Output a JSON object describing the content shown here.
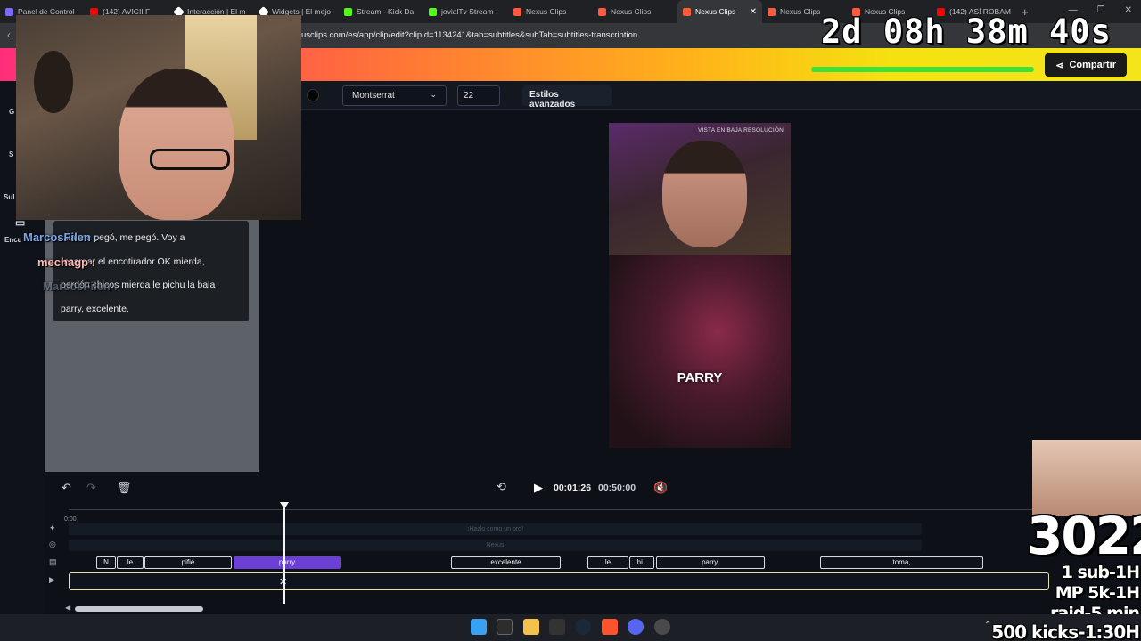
{
  "browser": {
    "tabs": [
      {
        "label": "Panel de Control",
        "color": "#7b6cff"
      },
      {
        "label": "(142) AVICII F",
        "color": "#ff0000"
      },
      {
        "label": "Interacción | El m",
        "color": "#ffffff"
      },
      {
        "label": "Widgets | El mejo",
        "color": "#ffffff"
      },
      {
        "label": "Stream - Kick Da",
        "color": "#53fc18"
      },
      {
        "label": "jovialTv Stream -",
        "color": "#53fc18"
      },
      {
        "label": "Nexus Clips",
        "color": "#ff5a3c"
      },
      {
        "label": "Nexus Clips",
        "color": "#ff5a3c"
      },
      {
        "label": "Nexus Clips",
        "color": "#ff5a3c",
        "active": true
      },
      {
        "label": "Nexus Clips",
        "color": "#ff5a3c"
      },
      {
        "label": "Nexus Clips",
        "color": "#ff5a3c"
      },
      {
        "label": "(142) ASÍ ROBAM",
        "color": "#ff0000"
      }
    ],
    "url": "usclips.com/es/app/clip/edit?clipId=1134241&tab=subtitles&subTab=subtitles-transcription"
  },
  "header": {
    "share_label": "Compartir"
  },
  "sidebar": {
    "items": [
      "G",
      "S",
      "Sul",
      "Encu"
    ]
  },
  "toolbar": {
    "font": "Montserrat",
    "size": "22",
    "advanced_label": "Estilos avanzados"
  },
  "transcript": {
    "lines": [
      "...la me pegó, me pegó. Voy a",
      "recargar el encotirador OK mierda,",
      "perdón chicos mierda le pichu la bala",
      "parry, excelente."
    ]
  },
  "chat": {
    "names": [
      "MarcosFilen :",
      "mechagp :",
      "MarcosFilen :"
    ]
  },
  "preview": {
    "lowres_label": "VISTA EN BAJA RESOLUCIÓN",
    "caption": "PARRY"
  },
  "player": {
    "current": "00:01:26",
    "total": "00:50:00"
  },
  "timeline": {
    "start_label": "0:00",
    "ghost_tracks": [
      "¡Hazlo como un pro!",
      "Nexus"
    ],
    "segments": [
      "N",
      "le",
      "pifié",
      "parry",
      "excelente",
      "le",
      "hi..",
      "parry,",
      "toma,"
    ]
  },
  "overlay": {
    "countdown": "2d 08h 38m 40s",
    "big_number": "3022",
    "goals": [
      "1 sub-1H",
      "MP 5k-1H",
      "raid-5 min",
      "500 kicks-1:30H"
    ]
  },
  "colors": {
    "accent": "#6b3fd6",
    "kick_green": "#53fc18"
  }
}
